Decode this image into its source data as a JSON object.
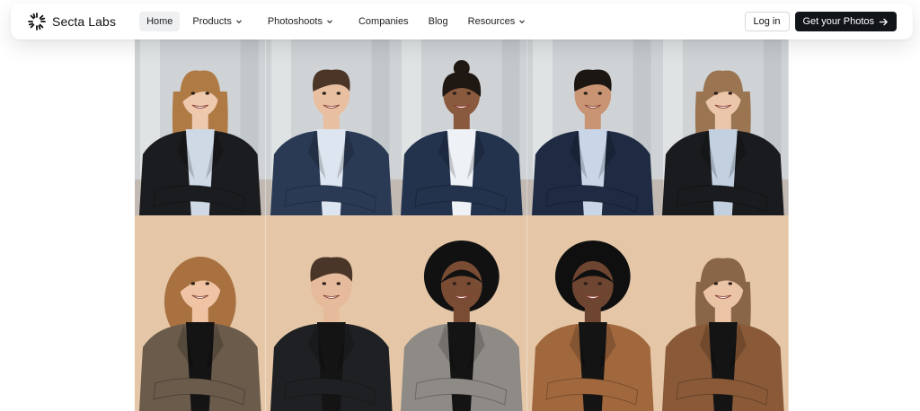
{
  "brand": {
    "name": "Secta Labs",
    "logo_icon": "sunburst-logo-icon"
  },
  "nav": {
    "items": [
      {
        "label": "Home",
        "active": true,
        "dropdown": false
      },
      {
        "label": "Products",
        "active": false,
        "dropdown": true
      },
      {
        "label": "Photoshoots",
        "active": false,
        "dropdown": true
      },
      {
        "label": "Companies",
        "active": false,
        "dropdown": false
      },
      {
        "label": "Blog",
        "active": false,
        "dropdown": false
      },
      {
        "label": "Resources",
        "active": false,
        "dropdown": true
      }
    ],
    "login_label": "Log in",
    "cta_label": "Get your Photos"
  },
  "colors": {
    "cta_bg": "#111418",
    "active_nav_bg": "#eef0f2",
    "office_bg": "#cfd3d6",
    "studio_bg": "#e2c2a1"
  },
  "gallery": {
    "rows": [
      {
        "background": "office",
        "people": [
          {
            "hair": "#b07a45",
            "hairstyle": "long",
            "skin": "#efc9ad",
            "suit": "#1b1c1f",
            "shirt": "#cfd9e6"
          },
          {
            "hair": "#4a3526",
            "hairstyle": "short",
            "skin": "#e8bfa1",
            "suit": "#2a3a55",
            "shirt": "#dde6f0"
          },
          {
            "hair": "#1e1712",
            "hairstyle": "bun",
            "skin": "#8a5a3e",
            "suit": "#23324d",
            "shirt": "#eef2f6"
          },
          {
            "hair": "#1c1612",
            "hairstyle": "short",
            "skin": "#c99474",
            "suit": "#1f2b43",
            "shirt": "#c8d6e8"
          },
          {
            "hair": "#9b7552",
            "hairstyle": "long",
            "skin": "#ecc6aa",
            "suit": "#1a1b1e",
            "shirt": "#c2d0e0"
          }
        ]
      },
      {
        "background": "studio",
        "people": [
          {
            "hair": "#a8713f",
            "hairstyle": "curly",
            "skin": "#efc3a4",
            "suit": "#6a5b4b",
            "shirt": "#141414"
          },
          {
            "hair": "#4a3628",
            "hairstyle": "short",
            "skin": "#e6bb9c",
            "suit": "#1f2023",
            "shirt": "#141414"
          },
          {
            "hair": "#111111",
            "hairstyle": "afro",
            "skin": "#7a4c34",
            "suit": "#8e8a86",
            "shirt": "#141414"
          },
          {
            "hair": "#0f0f0f",
            "hairstyle": "afro",
            "skin": "#6e4530",
            "suit": "#a2683d",
            "shirt": "#141414"
          },
          {
            "hair": "#8a6648",
            "hairstyle": "long",
            "skin": "#ebc4a6",
            "suit": "#8a5a38",
            "shirt": "#141414"
          }
        ]
      }
    ]
  }
}
